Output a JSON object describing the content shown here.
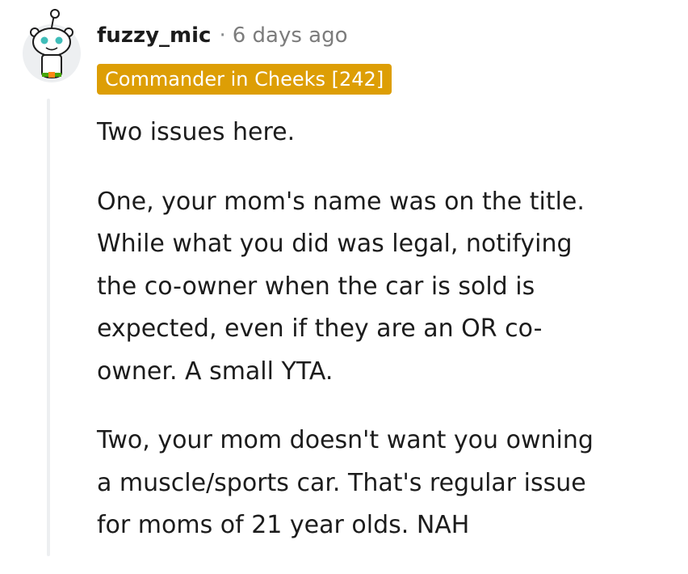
{
  "comment": {
    "author": "fuzzy_mic",
    "separator": "·",
    "time": "6 days ago",
    "flair": "Commander in Cheeks [242]",
    "paragraphs": [
      [
        "Two issues here."
      ],
      [
        "One, your mom's name was on the title.",
        "While what you did was legal, notifying",
        "the co-owner when the car is sold is",
        "expected, even if they are an OR co-",
        "owner. A small YTA."
      ],
      [
        "Two, your mom doesn't want you owning",
        "a muscle/sports car. That's regular issue",
        "for moms of 21 year olds. NAH"
      ]
    ]
  },
  "colors": {
    "flair_background": "#dd9e05",
    "thread_line": "#edeff1",
    "avatar_accent": "#3fbdb9"
  },
  "icons": {
    "avatar": "snoo-avatar-icon"
  }
}
